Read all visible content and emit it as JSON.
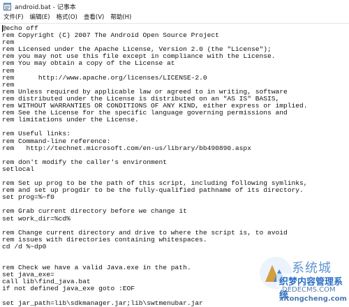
{
  "window": {
    "title": "android.bat - 记事本"
  },
  "menu": {
    "items": [
      "文件(F)",
      "编辑(E)",
      "格式(O)",
      "查看(V)",
      "帮助(H)"
    ]
  },
  "editor": {
    "lines": [
      "@echo off",
      "rem Copyright (C) 2007 The Android Open Source Project",
      "rem",
      "rem Licensed under the Apache License, Version 2.0 (the \"License\");",
      "rem you may not use this file except in compliance with the License.",
      "rem You may obtain a copy of the License at",
      "rem",
      "rem      http://www.apache.org/licenses/LICENSE-2.0",
      "rem",
      "rem Unless required by applicable law or agreed to in writing, software",
      "rem distributed under the License is distributed on an \"AS IS\" BASIS,",
      "rem WITHOUT WARRANTIES OR CONDITIONS OF ANY KIND, either express or implied.",
      "rem See the License for the specific language governing permissions and",
      "rem limitations under the License.",
      "",
      "rem Useful links:",
      "rem Command-line reference:",
      "rem   http://technet.microsoft.com/en-us/library/bb490890.aspx",
      "",
      "rem don't modify the caller's environment",
      "setlocal",
      "",
      "rem Set up prog to be the path of this script, including following symlinks,",
      "rem and set up progdir to be the fully-qualified pathname of its directory.",
      "set prog=%~f0",
      "",
      "rem Grab current directory before we change it",
      "set work_dir=%cd%",
      "",
      "rem Change current directory and drive to where the script is, to avoid",
      "rem issues with directories containing whitespaces.",
      "cd /d %~dp0",
      "",
      "",
      "rem Check we have a valid Java.exe in the path.",
      "set java_exe=",
      "call lib\\find_java.bat",
      "if not defined java_exe goto :EOF",
      "",
      "set jar_path=lib\\sdkmanager.jar;lib\\swtmenubar.jar"
    ]
  },
  "watermark": {
    "brand": "系统城",
    "site_name": "织梦内容管理系统",
    "domain1": "DEDECMS.COM",
    "domain2": "xitongcheng.com"
  }
}
